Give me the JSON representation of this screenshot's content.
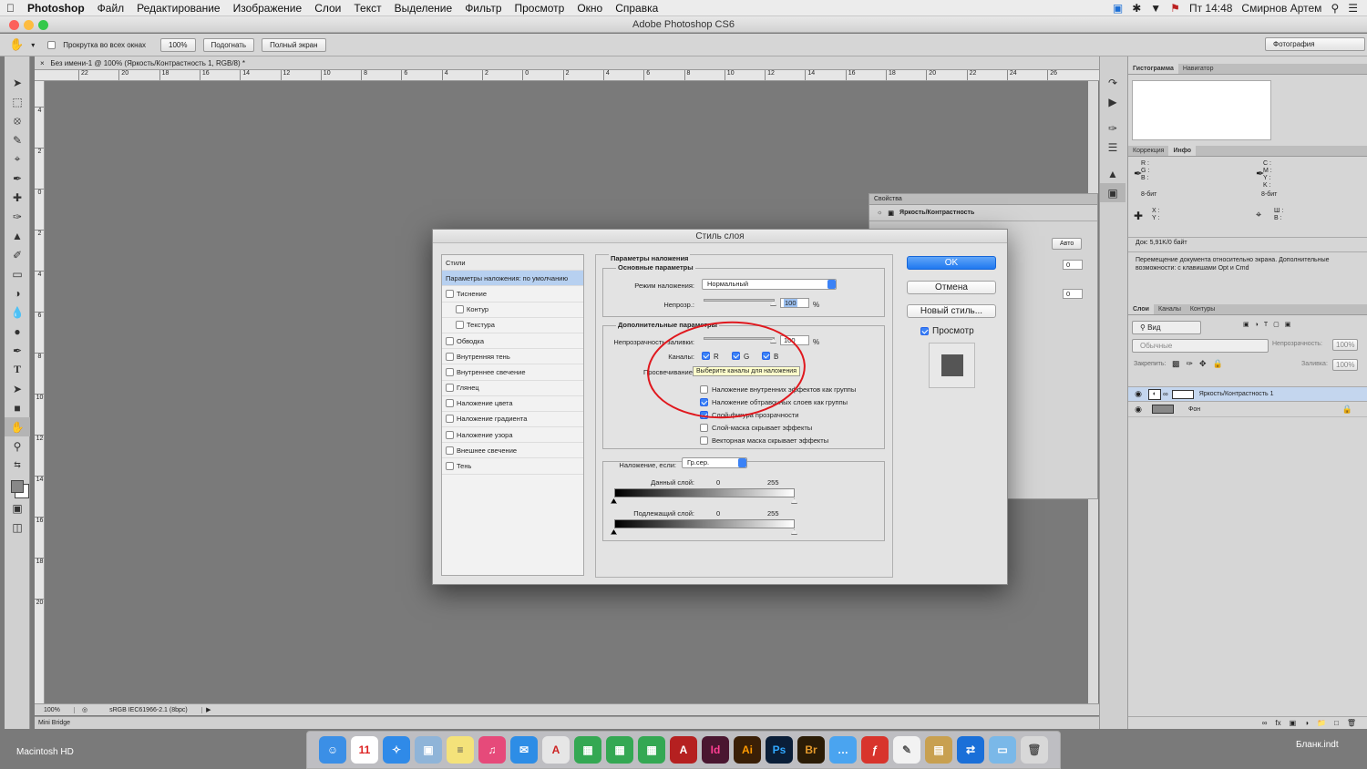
{
  "menubar": {
    "app": "Photoshop",
    "items": [
      "Файл",
      "Редактирование",
      "Изображение",
      "Слои",
      "Текст",
      "Выделение",
      "Фильтр",
      "Просмотр",
      "Окно",
      "Справка"
    ],
    "clock": "Пт 14:48",
    "user": "Смирнов Артем"
  },
  "window": {
    "title": "Adobe Photoshop CS6"
  },
  "options": {
    "scroll_all": "Прокрутка во всех окнах",
    "btn_100": "100%",
    "btn_fit": "Подогнать",
    "btn_full": "Полный экран",
    "workspace": "Фотография"
  },
  "document": {
    "tab": "Без имени-1 @ 100% (Яркость/Контрастность 1, RGB/8) *",
    "ruler_h": [
      "22",
      "20",
      "18",
      "16",
      "14",
      "12",
      "10",
      "8",
      "6",
      "4",
      "2",
      "0",
      "2",
      "4",
      "6",
      "8",
      "10",
      "12",
      "14",
      "16",
      "18",
      "20",
      "22",
      "24",
      "26"
    ],
    "ruler_v": [
      "4",
      "2",
      "0",
      "2",
      "4",
      "6",
      "8",
      "10",
      "12",
      "14",
      "16",
      "18",
      "20"
    ],
    "zoom": "100%",
    "profile": "sRGB IEC61966-2.1 (8bpc)",
    "mini_bridge": "Mini Bridge"
  },
  "right_panel": {
    "tabs_top": [
      "Гистограмма",
      "Навигатор"
    ],
    "tabs_info": [
      "Коррекция",
      "Инфо"
    ],
    "rgb_labels": [
      "R :",
      "G :",
      "B :"
    ],
    "cmyk_labels": [
      "C :",
      "M :",
      "Y :",
      "K :"
    ],
    "bit_left": "8-бит",
    "bit_right": "8-бит",
    "xy_labels": [
      "X :",
      "Y :"
    ],
    "wh_labels": [
      "Ш :",
      "В :"
    ],
    "doc_size": "Док: 5,91K/0 байт",
    "hint": "Перемещение документа относительно экрана. Дополнительные возможности: с клавишами Opt и Cmd",
    "layer_tabs": [
      "Слои",
      "Каналы",
      "Контуры"
    ],
    "filter_kind": "Вид",
    "blend_mode": "Обычные",
    "opacity_label": "Непрозрачность:",
    "opacity_val": "100%",
    "lock_label": "Закрепить:",
    "fill_label": "Заливка:",
    "fill_val": "100%",
    "layers": [
      {
        "name": "Яркость/Контрастность 1"
      },
      {
        "name": "Фон"
      }
    ]
  },
  "properties": {
    "title": "Свойства",
    "subtitle": "Яркость/Контрастность",
    "auto_btn": "Авто",
    "brightness": "0",
    "contrast": "0"
  },
  "dialog": {
    "title": "Стиль слоя",
    "styles": [
      {
        "label": "Стили",
        "type": "hdr"
      },
      {
        "label": "Параметры наложения: по умолчанию",
        "type": "sel"
      },
      {
        "label": "Тиснение",
        "type": "chk"
      },
      {
        "label": "Контур",
        "type": "sub"
      },
      {
        "label": "Текстура",
        "type": "sub"
      },
      {
        "label": "Обводка",
        "type": "chk"
      },
      {
        "label": "Внутренняя тень",
        "type": "chk"
      },
      {
        "label": "Внутреннее свечение",
        "type": "chk"
      },
      {
        "label": "Глянец",
        "type": "chk"
      },
      {
        "label": "Наложение цвета",
        "type": "chk"
      },
      {
        "label": "Наложение градиента",
        "type": "chk"
      },
      {
        "label": "Наложение узора",
        "type": "chk"
      },
      {
        "label": "Внешнее свечение",
        "type": "chk"
      },
      {
        "label": "Тень",
        "type": "chk"
      }
    ],
    "section_title": "Параметры наложения",
    "basic_title": "Основные параметры",
    "blend_mode_label": "Режим наложения:",
    "blend_mode_val": "Нормальный",
    "opacity_label": "Непрозр.:",
    "opacity_val": "100",
    "pct": "%",
    "advanced_title": "Дополнительные параметры",
    "fill_label": "Непрозрачность заливки:",
    "fill_val": "100",
    "channels_label": "Каналы:",
    "ch_r": "R",
    "ch_g": "G",
    "ch_b": "B",
    "knockout_label": "Просвечивание:",
    "tooltip": "Выберите каналы для наложения",
    "options": [
      {
        "label": "Наложение внутренних эффектов как группы",
        "checked": false
      },
      {
        "label": "Наложение обтравочных слоев как группы",
        "checked": true
      },
      {
        "label": "Слой-фигура прозрачности",
        "checked": true
      },
      {
        "label": "Слой-маска скрывает эффекты",
        "checked": false
      },
      {
        "label": "Векторная маска скрывает эффекты",
        "checked": false
      }
    ],
    "blend_if_label": "Наложение, если:",
    "blend_if_val": "Гр.сер.",
    "this_layer": "Данный слой:",
    "underlying": "Подлежащий слой:",
    "v0": "0",
    "v255": "255",
    "ok": "OK",
    "cancel": "Отмена",
    "new_style": "Новый стиль...",
    "preview": "Просмотр"
  },
  "desktop": {
    "hd": "Macintosh HD",
    "file": "Бланк.indt"
  },
  "dock": [
    "Finder",
    "11",
    "Safari",
    "Preview",
    "Notes",
    "iTunes",
    "Mail",
    "PDF",
    "Numbers",
    "Numbers",
    "Numbers",
    "Acrobat",
    "Id",
    "Ai",
    "Ps",
    "Br",
    "Messages",
    "Flash",
    "TextEdit",
    "Archive",
    "TeamViewer",
    "Folder",
    "Trash"
  ],
  "colors": {
    "accent": "#1f78f0",
    "annotation": "#e0181e",
    "tooltip": "#ffffcc"
  }
}
